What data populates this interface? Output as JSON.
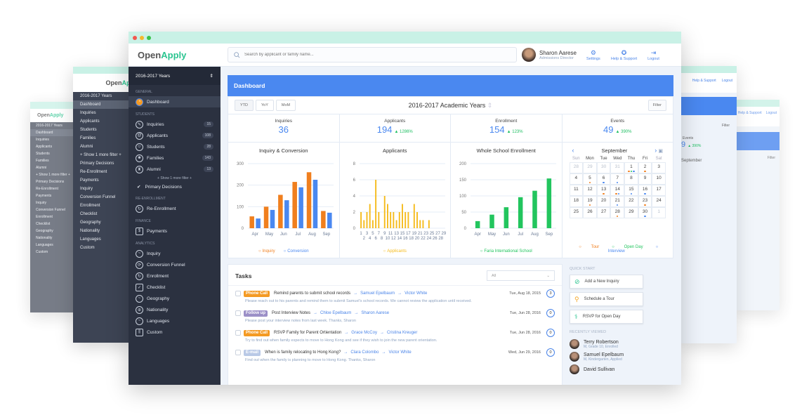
{
  "app": {
    "logo_a": "Open",
    "logo_b": "Apply"
  },
  "header": {
    "search_placeholder": "Search by applicant or family name...",
    "user_name": "Sharon Aarese",
    "user_role": "Admissions Director",
    "actions": [
      {
        "label": "Settings",
        "icon": "gear-icon"
      },
      {
        "label": "Help & Support",
        "icon": "lifebuoy-icon"
      },
      {
        "label": "Logout",
        "icon": "logout-icon"
      }
    ]
  },
  "sidebar": {
    "year_select": "2016-2017 Years",
    "general_label": "GENERAL",
    "dashboard": "Dashboard",
    "students_label": "STUDENTS",
    "students": [
      {
        "label": "Inquiries",
        "count": "15"
      },
      {
        "label": "Applicants",
        "count": "108"
      },
      {
        "label": "Students",
        "count": "28"
      },
      {
        "label": "Families",
        "count": "143"
      },
      {
        "label": "Alumni",
        "count": "13"
      }
    ],
    "show_more": "+ Show 1 more filter +",
    "primary_decisions": "Primary Decisions",
    "reenrollment_label": "RE-ENROLLMENT",
    "reenrollment": "Re-Enrollment",
    "finance_label": "FINANCE",
    "payments": "Payments",
    "analytics_label": "ANALYTICS",
    "analytics": [
      "Inquiry",
      "Conversion Funnel",
      "Enrollment",
      "Checklist",
      "Geography",
      "Nationality",
      "Languages",
      "Custom"
    ]
  },
  "dashboard": {
    "title": "Dashboard",
    "range_buttons": [
      "YTD",
      "YoY",
      "MoM"
    ],
    "period_title": "2016-2017 Academic Years",
    "filter": "Filter",
    "stats": [
      {
        "label": "Inquiries",
        "value": "36",
        "change": ""
      },
      {
        "label": "Applicants",
        "value": "194",
        "change": "▲ 1286%"
      },
      {
        "label": "Enrollment",
        "value": "154",
        "change": "▲ 123%"
      },
      {
        "label": "Events",
        "value": "49",
        "change": "▲ 390%"
      }
    ]
  },
  "chart_data": [
    {
      "type": "bar",
      "title": "Inquiry & Conversion",
      "categories": [
        "Apr",
        "May",
        "Jun",
        "Jul",
        "Aug",
        "Sep"
      ],
      "series": [
        {
          "name": "Inquiry",
          "color": "#f07f1e",
          "values": [
            55,
            100,
            155,
            215,
            260,
            80
          ]
        },
        {
          "name": "Conversion",
          "color": "#4a88f0",
          "values": [
            45,
            85,
            130,
            190,
            225,
            72
          ]
        }
      ],
      "yticks": [
        0,
        100,
        200,
        300
      ],
      "ylim": [
        0,
        300
      ]
    },
    {
      "type": "bar",
      "title": "Applicants",
      "categories": [
        "1",
        "2",
        "3",
        "4",
        "5",
        "6",
        "7",
        "8",
        "9",
        "10",
        "11",
        "12",
        "13",
        "14",
        "15",
        "16",
        "17",
        "18",
        "19",
        "20",
        "21",
        "22",
        "23",
        "24",
        "25",
        "26",
        "27",
        "28",
        "29"
      ],
      "series": [
        {
          "name": "Applicants",
          "color": "#f5bb1c",
          "values": [
            2,
            1,
            2,
            3,
            1,
            6,
            2,
            0,
            4,
            3,
            2,
            2,
            1,
            2,
            3,
            2,
            2,
            0,
            3,
            2,
            1,
            1,
            0,
            1,
            0,
            0,
            0,
            0,
            0
          ]
        }
      ],
      "yticks": [
        0,
        2,
        4,
        6,
        8
      ],
      "ylim": [
        0,
        8
      ]
    },
    {
      "type": "bar",
      "title": "Whole School Enrollment",
      "categories": [
        "Apr",
        "May",
        "Jun",
        "Jul",
        "Aug",
        "Sep"
      ],
      "series": [
        {
          "name": "Faria International School",
          "color": "#22c55e",
          "values": [
            22,
            42,
            65,
            96,
            116,
            154
          ]
        }
      ],
      "yticks": [
        0,
        50,
        100,
        150,
        200
      ],
      "ylim": [
        0,
        200
      ]
    }
  ],
  "calendar": {
    "month": "September",
    "dow": [
      "Sun",
      "Mon",
      "Tue",
      "Wed",
      "Thu",
      "Fri",
      "Sat"
    ],
    "days": [
      {
        "d": "28",
        "m": true,
        "e": []
      },
      {
        "d": "29",
        "m": true,
        "e": []
      },
      {
        "d": "30",
        "m": true,
        "e": []
      },
      {
        "d": "31",
        "m": true,
        "e": []
      },
      {
        "d": "1",
        "e": [
          "t",
          "o",
          "i"
        ]
      },
      {
        "d": "2",
        "e": [
          "t"
        ]
      },
      {
        "d": "3",
        "e": []
      },
      {
        "d": "4",
        "e": []
      },
      {
        "d": "5",
        "e": [
          "t"
        ]
      },
      {
        "d": "6",
        "e": [
          "i"
        ]
      },
      {
        "d": "7",
        "e": [
          "i"
        ]
      },
      {
        "d": "8",
        "e": []
      },
      {
        "d": "9",
        "e": []
      },
      {
        "d": "10",
        "e": []
      },
      {
        "d": "11",
        "e": []
      },
      {
        "d": "12",
        "e": []
      },
      {
        "d": "13",
        "e": [
          "t"
        ]
      },
      {
        "d": "14",
        "e": [
          "t",
          "i"
        ]
      },
      {
        "d": "15",
        "e": [
          "i"
        ]
      },
      {
        "d": "16",
        "e": [
          "i"
        ]
      },
      {
        "d": "17",
        "e": []
      },
      {
        "d": "18",
        "e": []
      },
      {
        "d": "19",
        "e": [
          "t"
        ]
      },
      {
        "d": "20",
        "e": []
      },
      {
        "d": "21",
        "e": [
          "i"
        ]
      },
      {
        "d": "22",
        "e": []
      },
      {
        "d": "23",
        "e": [
          "t"
        ]
      },
      {
        "d": "24",
        "e": []
      },
      {
        "d": "25",
        "e": []
      },
      {
        "d": "26",
        "e": []
      },
      {
        "d": "27",
        "e": []
      },
      {
        "d": "28",
        "e": [
          "t"
        ]
      },
      {
        "d": "29",
        "e": []
      },
      {
        "d": "30",
        "e": [
          "i"
        ]
      },
      {
        "d": "1",
        "m": true,
        "e": []
      }
    ],
    "legend": [
      {
        "label": "Tour",
        "color": "#f07f1e"
      },
      {
        "label": "Open Day",
        "color": "#22c55e"
      },
      {
        "label": "Interview",
        "color": "#4a88f0"
      }
    ]
  },
  "tasks": {
    "title": "Tasks",
    "filter_value": "All",
    "items": [
      {
        "tag": "Phone Call",
        "tag_color": "#f49a23",
        "title": "Remind parents to submit school records",
        "from": "Samuel Epelbaum",
        "to": "Victor White",
        "date": "Tue, Aug 18, 2015",
        "count": "3",
        "desc": "Please reach out to his parents and remind them to submit Samuel's school records. We cannot review the application until received."
      },
      {
        "tag": "Follow up",
        "tag_color": "#9b8fc7",
        "title": "Post Interview Notes",
        "from": "Chloe Epelbaum",
        "to": "Sharon Aarese",
        "date": "Tue, Jun 28, 2016",
        "count": "0",
        "desc": "Please post your interview notes from last week. Thanks, Sharon"
      },
      {
        "tag": "Phone Call",
        "tag_color": "#f49a23",
        "title": "RSVP Family for Parent Ortientation",
        "from": "Grace McCoy",
        "to": "Cristina Kreuger",
        "date": "Tue, Jun 28, 2016",
        "count": "0",
        "desc": "Try to find out when family expects to move to Hong Kong and see if they wish to join the new parent orientation."
      },
      {
        "tag": "E-mail",
        "tag_color": "#b9c9e6",
        "title": "When is family relocating to Hong Kong?",
        "from": "Clara Colombo",
        "to": "Victor White",
        "date": "Wed, Jun 29, 2016",
        "count": "0",
        "desc": "Find out when the family is planning to move to Hong Kong. Thanks, Sharon"
      }
    ]
  },
  "quick_start": {
    "title": "QUICK START",
    "buttons": [
      {
        "label": "Add a New Inquiry",
        "icon": "pencil-circle-icon"
      },
      {
        "label": "Schedule a Tour",
        "icon": "map-pin-icon"
      },
      {
        "label": "RSVP for Open Day",
        "icon": "signpost-icon"
      }
    ]
  },
  "recently_viewed": {
    "title": "RECENTLY VIEWED",
    "items": [
      {
        "name": "Terry Robertson",
        "sub": "M, Grade 10, Enrolled"
      },
      {
        "name": "Samuel Epelbaum",
        "sub": "M, Kindergarten, Applied"
      },
      {
        "name": "David Sullivan",
        "sub": ""
      }
    ]
  },
  "bg_windows": {
    "year": "2016-2017 Years",
    "dashboard": "Dashboard",
    "students": [
      "Inquiries",
      "Applicants",
      "Students",
      "Families",
      "Alumni"
    ],
    "show_more": "+ Show 1 more filter +",
    "primary": "Primary Decisions",
    "reenroll": "Re-Enrollment",
    "payments": "Payments",
    "analytics": [
      "Inquiry",
      "Conversion Funnel",
      "Enrollment",
      "Checklist",
      "Geography",
      "Nationality",
      "Languages",
      "Custom"
    ],
    "help": "Help & Support",
    "logout": "Logout",
    "filter": "Filter",
    "events_label": "Events",
    "events_val": "9",
    "events_chg": "▲ 390%",
    "month": "September"
  }
}
